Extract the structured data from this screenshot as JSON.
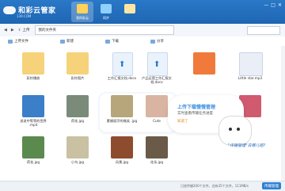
{
  "app": {
    "title": "和彩云管家",
    "subtitle": "139.COM",
    "accent": "#1e66b2"
  },
  "header": {
    "tabs": [
      {
        "label": "我的彩云",
        "icon": "cloud-drive-icon",
        "active": true
      },
      {
        "label": "同步",
        "icon": "sync-icon",
        "active": false
      },
      {
        "label": "",
        "icon": "mail-icon",
        "active": false
      }
    ],
    "window_buttons": [
      "minimize-icon",
      "maximize-icon",
      "close-icon"
    ]
  },
  "toolbar": {
    "upload_label": "上传",
    "breadcrumb": "我的文件夹",
    "search_placeholder": ""
  },
  "actions": [
    {
      "label": "上传文件",
      "icon": "upload-icon"
    },
    {
      "label": "新建",
      "icon": "new-folder-icon"
    },
    {
      "label": "下载",
      "icon": "download-icon"
    },
    {
      "label": "分享",
      "icon": "share-icon"
    }
  ],
  "files": [
    {
      "name": "彩铃播放",
      "type": "folder"
    },
    {
      "name": "彩铃图片",
      "type": "folder"
    },
    {
      "name": "工作汇报文档.docx",
      "type": "doc"
    },
    {
      "name": "产品运营工作汇报文档.docx",
      "type": "doc"
    },
    {
      "name": "",
      "type": "ppt"
    },
    {
      "name": "Little star.mp3",
      "type": "audio"
    },
    {
      "name": "说说中等等的世界 .mp4",
      "type": "video"
    },
    {
      "name": "荷花.jpg",
      "type": "image"
    },
    {
      "name": "蒙娜丽莎的微笑 .jpg",
      "type": "image"
    },
    {
      "name": "Cute",
      "type": "image"
    },
    {
      "name": "",
      "type": "image"
    },
    {
      "name": "",
      "type": "image"
    },
    {
      "name": "荷花.jpg",
      "type": "image"
    },
    {
      "name": "小鸟.jpg",
      "type": "image"
    },
    {
      "name": "风景.jpg",
      "type": "image"
    },
    {
      "name": "花朵.jpg",
      "type": "image"
    },
    {
      "name": "",
      "type": "image"
    },
    {
      "name": "",
      "type": "image"
    }
  ],
  "tooltip": {
    "title": "上传下载慢慢管理",
    "subtitle": "实时查看传输任务进度",
    "link": "知道了",
    "speech": "\"传输管理\"去哪儿呢?"
  },
  "status": {
    "text": "已经传输200个文件，还有35个文件，111MB/s",
    "transfer_button": "传输管理"
  }
}
